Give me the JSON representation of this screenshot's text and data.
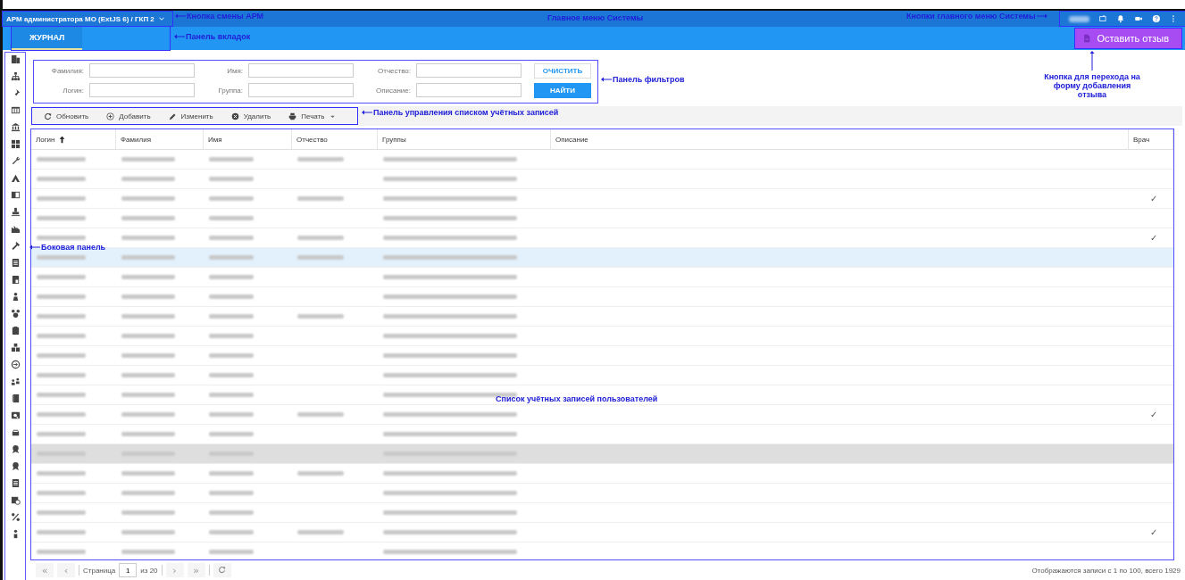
{
  "header": {
    "app_switch": "АРМ администратора МО (ExtJS 6) / ГКП 2"
  },
  "tabs": [
    {
      "label": "ЖУРНАЛ",
      "selected": true
    }
  ],
  "feedback_button": "Оставить отзыв",
  "filters": [
    {
      "label": "Фамилия:"
    },
    {
      "label": "Имя:"
    },
    {
      "label": "Отчество:"
    },
    {
      "label": "Логин:"
    },
    {
      "label": "Группа:"
    },
    {
      "label": "Описание:"
    }
  ],
  "filter_buttons": [
    {
      "label": "ОЧИСТИТЬ",
      "kind": "outline"
    },
    {
      "label": "НАЙТИ",
      "kind": "primary"
    }
  ],
  "toolbar": [
    {
      "label": "Обновить",
      "menu": false
    },
    {
      "label": "Добавить",
      "menu": false
    },
    {
      "label": "Изменить",
      "menu": false
    },
    {
      "label": "Удалить",
      "menu": false
    },
    {
      "label": "Печать",
      "menu": true
    }
  ],
  "table": {
    "columns": [
      {
        "label": "Логин",
        "sorted": true
      },
      {
        "label": "Фамилия",
        "sorted": false
      },
      {
        "label": "Имя",
        "sorted": false
      },
      {
        "label": "Отчество",
        "sorted": false
      },
      {
        "label": "Группы",
        "sorted": false
      },
      {
        "label": "Описание",
        "sorted": false
      },
      {
        "label": "Врач",
        "sorted": false
      }
    ],
    "rows": [
      {
        "selected": false,
        "highlighted": false,
        "patronymic_shown": true
      },
      {
        "selected": false,
        "highlighted": false,
        "patronymic_shown": false
      },
      {
        "selected": false,
        "highlighted": false,
        "patronymic_shown": true,
        "doctor": "✓"
      },
      {
        "selected": false,
        "highlighted": false,
        "patronymic_shown": false
      },
      {
        "selected": false,
        "highlighted": false,
        "patronymic_shown": true,
        "doctor": "✓"
      },
      {
        "selected": true,
        "highlighted": false,
        "patronymic_shown": true
      },
      {
        "selected": false,
        "highlighted": false,
        "patronymic_shown": false
      },
      {
        "selected": false,
        "highlighted": false,
        "patronymic_shown": false
      },
      {
        "selected": false,
        "highlighted": false,
        "patronymic_shown": true
      },
      {
        "selected": false,
        "highlighted": false,
        "patronymic_shown": false
      },
      {
        "selected": false,
        "highlighted": false,
        "patronymic_shown": false
      },
      {
        "selected": false,
        "highlighted": false,
        "patronymic_shown": false
      },
      {
        "selected": false,
        "highlighted": false,
        "patronymic_shown": false
      },
      {
        "selected": false,
        "highlighted": false,
        "patronymic_shown": true,
        "doctor": "✓"
      },
      {
        "selected": false,
        "highlighted": false,
        "patronymic_shown": false
      },
      {
        "selected": false,
        "highlighted": true,
        "patronymic_shown": false
      },
      {
        "selected": false,
        "highlighted": false,
        "patronymic_shown": true
      },
      {
        "selected": false,
        "highlighted": false,
        "patronymic_shown": false
      },
      {
        "selected": false,
        "highlighted": false,
        "patronymic_shown": false
      },
      {
        "selected": false,
        "highlighted": false,
        "patronymic_shown": true,
        "doctor": "✓"
      },
      {
        "selected": false,
        "highlighted": false,
        "patronymic_shown": false
      }
    ]
  },
  "pager": {
    "first": "«",
    "previous": "‹",
    "page_label": "Страница",
    "page": "1",
    "total": "из 20",
    "next": "›",
    "last": "»"
  },
  "summary": "Отображаются записи с 1 по 100, всего 1929",
  "annotations": [
    {
      "text": "Кнопка смены АРМ",
      "kind": "left"
    },
    {
      "text": "Главное меню Системы",
      "kind": "plain"
    },
    {
      "text": "Кнопки главного меню Системы",
      "kind": "right"
    },
    {
      "text": "Панель вкладок",
      "kind": "left"
    },
    {
      "text": "Панель фильтров",
      "kind": "left"
    },
    {
      "text": "Панель управления списком учётных записей",
      "kind": "left"
    },
    {
      "text": "Кнопка для перехода на форму добавления отзыва",
      "kind": "up"
    },
    {
      "text": "Боковая панель",
      "kind": "left"
    },
    {
      "text": "Список учётных записей пользователей",
      "kind": "plain"
    }
  ]
}
